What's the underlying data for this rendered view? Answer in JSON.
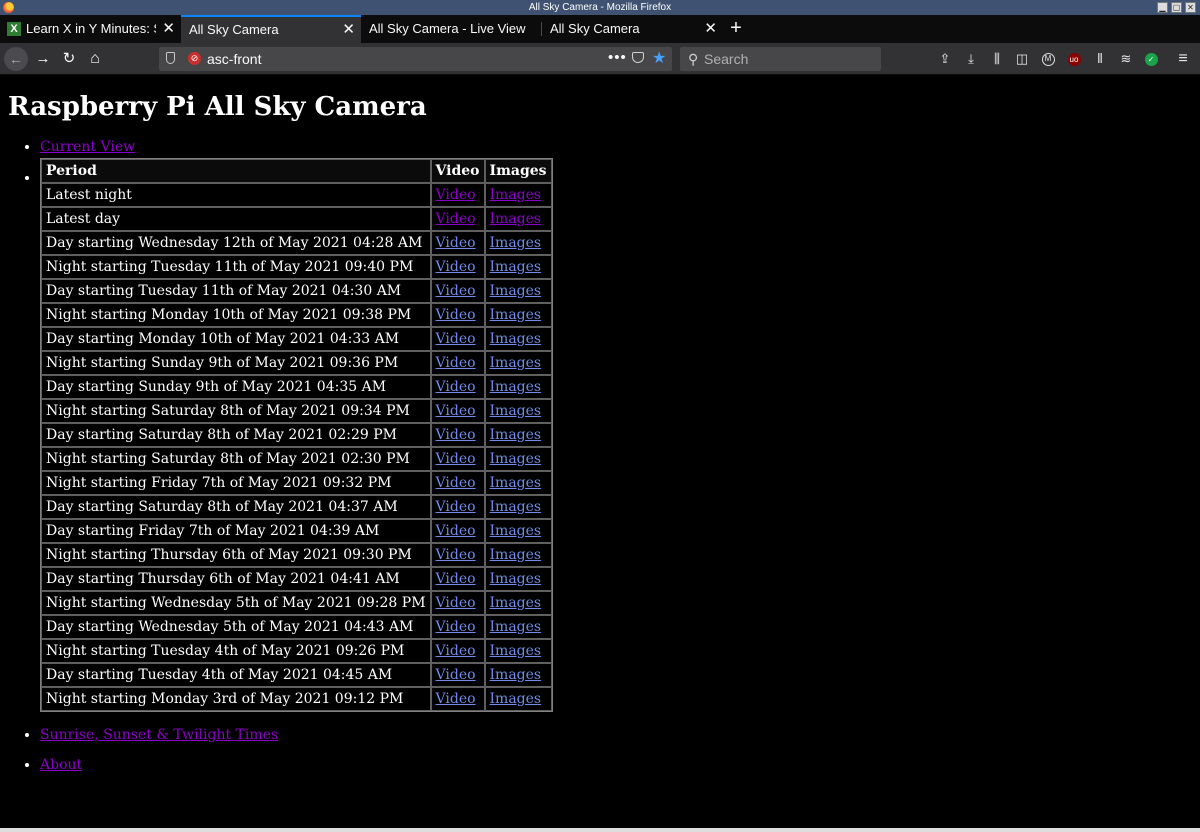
{
  "window": {
    "title": "All Sky Camera - Mozilla Firefox"
  },
  "tabs": [
    {
      "label": "Learn X in Y Minutes: S",
      "favicon": "X",
      "active": false
    },
    {
      "label": "All Sky Camera",
      "active": true
    },
    {
      "label": "All Sky Camera - Live View",
      "active": false
    },
    {
      "label": "All Sky Camera",
      "active": false
    }
  ],
  "toolbar": {
    "url": "asc-front",
    "search_placeholder": "Search",
    "icons": [
      "back-arrow-icon",
      "forward-arrow-icon",
      "reload-icon",
      "home-icon",
      "shield-icon",
      "more-actions-icon",
      "pocket-icon",
      "bookmark-star-icon",
      "search-icon",
      "upload-icon",
      "download-icon",
      "library-icon",
      "sidebar-icon",
      "extension-m-icon",
      "ublock-icon",
      "extension-bars-icon",
      "extension-scribble-icon",
      "extension-green-icon",
      "menu-icon"
    ],
    "accent_color": "#0a84ff",
    "star_color": "#45a1ff"
  },
  "page": {
    "title": "Raspberry Pi All Sky Camera",
    "nav": {
      "current_view": "Current View",
      "sunrise": "Sunrise, Sunset & Twilight Times",
      "about": "About"
    },
    "table": {
      "headers": [
        "Period",
        "Video",
        "Images"
      ],
      "rows": [
        {
          "period": "Latest night",
          "video": "Video",
          "images": "Images",
          "visited": true
        },
        {
          "period": "Latest day",
          "video": "Video",
          "images": "Images",
          "visited": true
        },
        {
          "period": "Day starting Wednesday 12th of May 2021 04:28 AM",
          "video": "Video",
          "images": "Images"
        },
        {
          "period": "Night starting Tuesday 11th of May 2021 09:40 PM",
          "video": "Video",
          "images": "Images"
        },
        {
          "period": "Day starting Tuesday 11th of May 2021 04:30 AM",
          "video": "Video",
          "images": "Images"
        },
        {
          "period": "Night starting Monday 10th of May 2021 09:38 PM",
          "video": "Video",
          "images": "Images"
        },
        {
          "period": "Day starting Monday 10th of May 2021 04:33 AM",
          "video": "Video",
          "images": "Images"
        },
        {
          "period": "Night starting Sunday 9th of May 2021 09:36 PM",
          "video": "Video",
          "images": "Images"
        },
        {
          "period": "Day starting Sunday 9th of May 2021 04:35 AM",
          "video": "Video",
          "images": "Images"
        },
        {
          "period": "Night starting Saturday 8th of May 2021 09:34 PM",
          "video": "Video",
          "images": "Images"
        },
        {
          "period": "Day starting Saturday 8th of May 2021 02:29 PM",
          "video": "Video",
          "images": "Images"
        },
        {
          "period": "Night starting Saturday 8th of May 2021 02:30 PM",
          "video": "Video",
          "images": "Images"
        },
        {
          "period": "Night starting Friday 7th of May 2021 09:32 PM",
          "video": "Video",
          "images": "Images"
        },
        {
          "period": "Day starting Saturday 8th of May 2021 04:37 AM",
          "video": "Video",
          "images": "Images"
        },
        {
          "period": "Day starting Friday 7th of May 2021 04:39 AM",
          "video": "Video",
          "images": "Images"
        },
        {
          "period": "Night starting Thursday 6th of May 2021 09:30 PM",
          "video": "Video",
          "images": "Images"
        },
        {
          "period": "Day starting Thursday 6th of May 2021 04:41 AM",
          "video": "Video",
          "images": "Images"
        },
        {
          "period": "Night starting Wednesday 5th of May 2021 09:28 PM",
          "video": "Video",
          "images": "Images"
        },
        {
          "period": "Day starting Wednesday 5th of May 2021 04:43 AM",
          "video": "Video",
          "images": "Images"
        },
        {
          "period": "Night starting Tuesday 4th of May 2021 09:26 PM",
          "video": "Video",
          "images": "Images"
        },
        {
          "period": "Day starting Tuesday 4th of May 2021 04:45 AM",
          "video": "Video",
          "images": "Images"
        },
        {
          "period": "Night starting Monday 3rd of May 2021 09:12 PM",
          "video": "Video",
          "images": "Images"
        }
      ]
    },
    "colors": {
      "background": "#000000",
      "link_visited": "#8b00c9",
      "link_unvisited": "#6f8ce8"
    }
  }
}
